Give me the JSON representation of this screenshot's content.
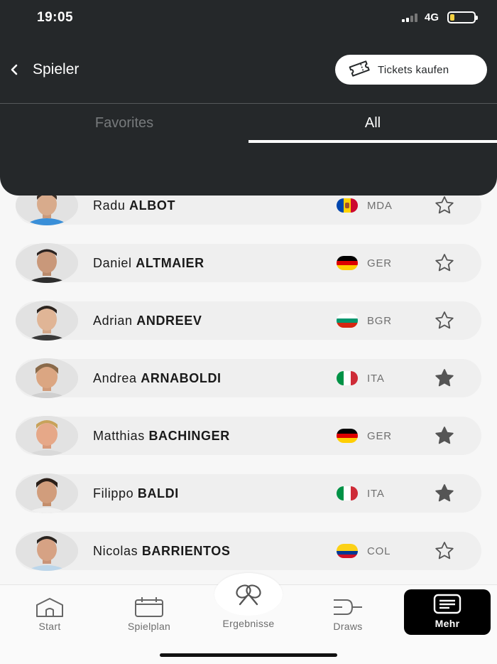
{
  "status_bar": {
    "time": "19:05",
    "network": "4G"
  },
  "header": {
    "back_icon": "chevron-left-icon",
    "title": "Spieler",
    "tickets_label": "Tickets kaufen",
    "tickets_icon": "ticket-icon"
  },
  "tabs": [
    {
      "label": "Favorites",
      "active": false
    },
    {
      "label": "All",
      "active": true
    }
  ],
  "players": [
    {
      "first": "Radu",
      "last": "ALBOT",
      "country": "MDA",
      "favorite": false
    },
    {
      "first": "Daniel",
      "last": "ALTMAIER",
      "country": "GER",
      "favorite": false
    },
    {
      "first": "Adrian",
      "last": "ANDREEV",
      "country": "BGR",
      "favorite": false
    },
    {
      "first": "Andrea",
      "last": "ARNABOLDI",
      "country": "ITA",
      "favorite": true
    },
    {
      "first": "Matthias",
      "last": "BACHINGER",
      "country": "GER",
      "favorite": true
    },
    {
      "first": "Filippo",
      "last": "BALDI",
      "country": "ITA",
      "favorite": true
    },
    {
      "first": "Nicolas",
      "last": "BARRIENTOS",
      "country": "COL",
      "favorite": false
    }
  ],
  "bottom_nav": {
    "start": "Start",
    "spielplan": "Spielplan",
    "ergebnisse": "Ergebnisse",
    "draws": "Draws",
    "mehr": "Mehr"
  },
  "colors": {
    "header_bg": "#25282a",
    "star_filled": "#555555",
    "accent_active_tab": "#ffffff"
  }
}
